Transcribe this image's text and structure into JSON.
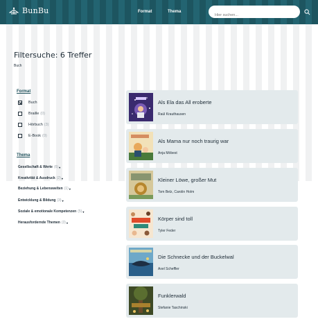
{
  "header": {
    "brand": "BunBu",
    "nav": [
      "Format",
      "Thema"
    ],
    "search_placeholder": "Hier suchen..."
  },
  "page": {
    "title": "Filtersuche: 6 Treffer",
    "subtitle": "Buch"
  },
  "sidebar": {
    "format_heading": "Format",
    "format_options": [
      {
        "label": "Buch",
        "checked": true,
        "count": ""
      },
      {
        "label": "Braille",
        "checked": false,
        "count": "(0)"
      },
      {
        "label": "Hörbuch",
        "checked": false,
        "count": "(3)"
      },
      {
        "label": "E-Book",
        "checked": false,
        "count": "(0)"
      }
    ],
    "theme_heading": "Thema",
    "themes": [
      {
        "label": "Gesellschaft & Werte",
        "count": "(6)"
      },
      {
        "label": "Kreativität & Ausdruck",
        "count": "(2)"
      },
      {
        "label": "Beziehung & Lebenswelten",
        "count": "(1)"
      },
      {
        "label": "Entwicklung & Bildung",
        "count": "(3)"
      },
      {
        "label": "Soziale & emotionale Kompetenzen",
        "count": "(5)"
      },
      {
        "label": "Herausfordernde Themen",
        "count": "(3)"
      }
    ]
  },
  "results": [
    {
      "title": "Als Ela das All eroberte",
      "author": "Raúl Krauthausen",
      "cover_colors": [
        "#3a2a6e",
        "#7a5bb5"
      ]
    },
    {
      "title": "Als Mama nur noch traurig war",
      "author": "Anja Möbest",
      "cover_colors": [
        "#f2e1b8",
        "#4a7a3a"
      ]
    },
    {
      "title": "Kleiner Löwe, großer Mut",
      "author": "Tom Belz, Carolin Holm",
      "cover_colors": [
        "#d6c89a",
        "#b6862e"
      ]
    },
    {
      "title": "Körper sind toll",
      "author": "Tyler Feder",
      "cover_colors": [
        "#f6e6d0",
        "#e04b2b"
      ]
    },
    {
      "title": "Die Schnecke und der Buckelwal",
      "author": "Axel Scheffler",
      "cover_colors": [
        "#2a5f8a",
        "#6ea8c8"
      ]
    },
    {
      "title": "Funklerwald",
      "author": "Stefanie Taschinski",
      "cover_colors": [
        "#3e4a25",
        "#a9802e"
      ]
    }
  ],
  "colors": {
    "header_bg": "#1d5560",
    "card_bg": "#e3eaec",
    "section_heading": "#1d4f5a"
  }
}
